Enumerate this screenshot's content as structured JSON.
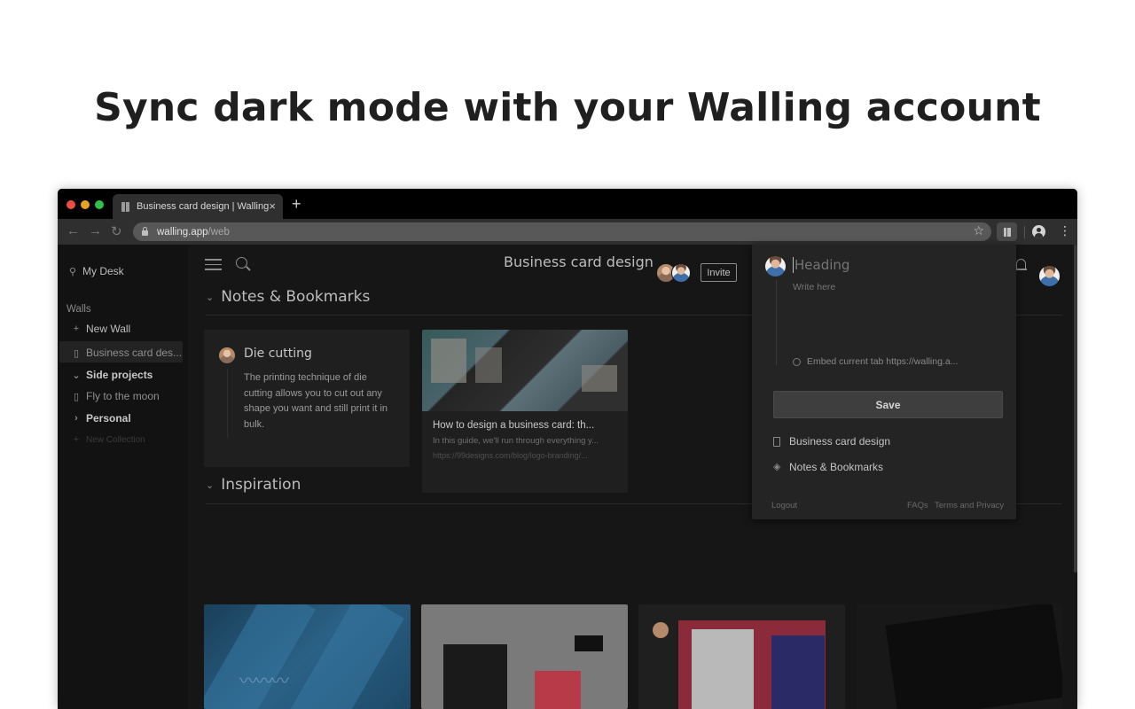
{
  "headline": "Sync dark mode with your Walling account",
  "browser": {
    "tab_title": "Business card design | Walling",
    "tab_close": "×",
    "new_tab": "+",
    "url_host": "walling.app",
    "url_path": "/web",
    "menu": "⋮"
  },
  "sidebar": {
    "my_desk": "My Desk",
    "walls_label": "Walls",
    "new_wall": "New Wall",
    "active_wall": "Business card des...",
    "collections": [
      {
        "name": "Side projects",
        "expanded": true,
        "walls": [
          "Fly to the moon"
        ]
      },
      {
        "name": "Personal",
        "expanded": false,
        "walls": []
      }
    ],
    "new_collection": "New Collection"
  },
  "header": {
    "board_title": "Business card design",
    "invite_label": "Invite"
  },
  "sections": {
    "notes_title": "Notes & Bookmarks",
    "inspiration_title": "Inspiration"
  },
  "note_card": {
    "title": "Die cutting",
    "body": "The printing technique of die cutting allows you to cut out any shape you want and still print it in bulk."
  },
  "bookmark_card": {
    "title": "How to design a business card: th...",
    "description": "In this guide, we'll run through everything y...",
    "url": "https://99designs.com/blog/logo-branding/..."
  },
  "popup": {
    "heading_placeholder": "Heading",
    "body_placeholder": "Write here",
    "embed_label": "Embed current tab https://walling.a...",
    "save_label": "Save",
    "destination_wall": "Business card design",
    "destination_section": "Notes & Bookmarks",
    "logout": "Logout",
    "faqs": "FAQs",
    "terms": "Terms and Privacy"
  },
  "colors": {
    "app_bg": "#161616",
    "sidebar_bg": "#121212",
    "popup_bg": "#242424",
    "traffic_red": "#ee4c45",
    "traffic_yellow": "#e6a51c",
    "traffic_green": "#2ec04a"
  }
}
